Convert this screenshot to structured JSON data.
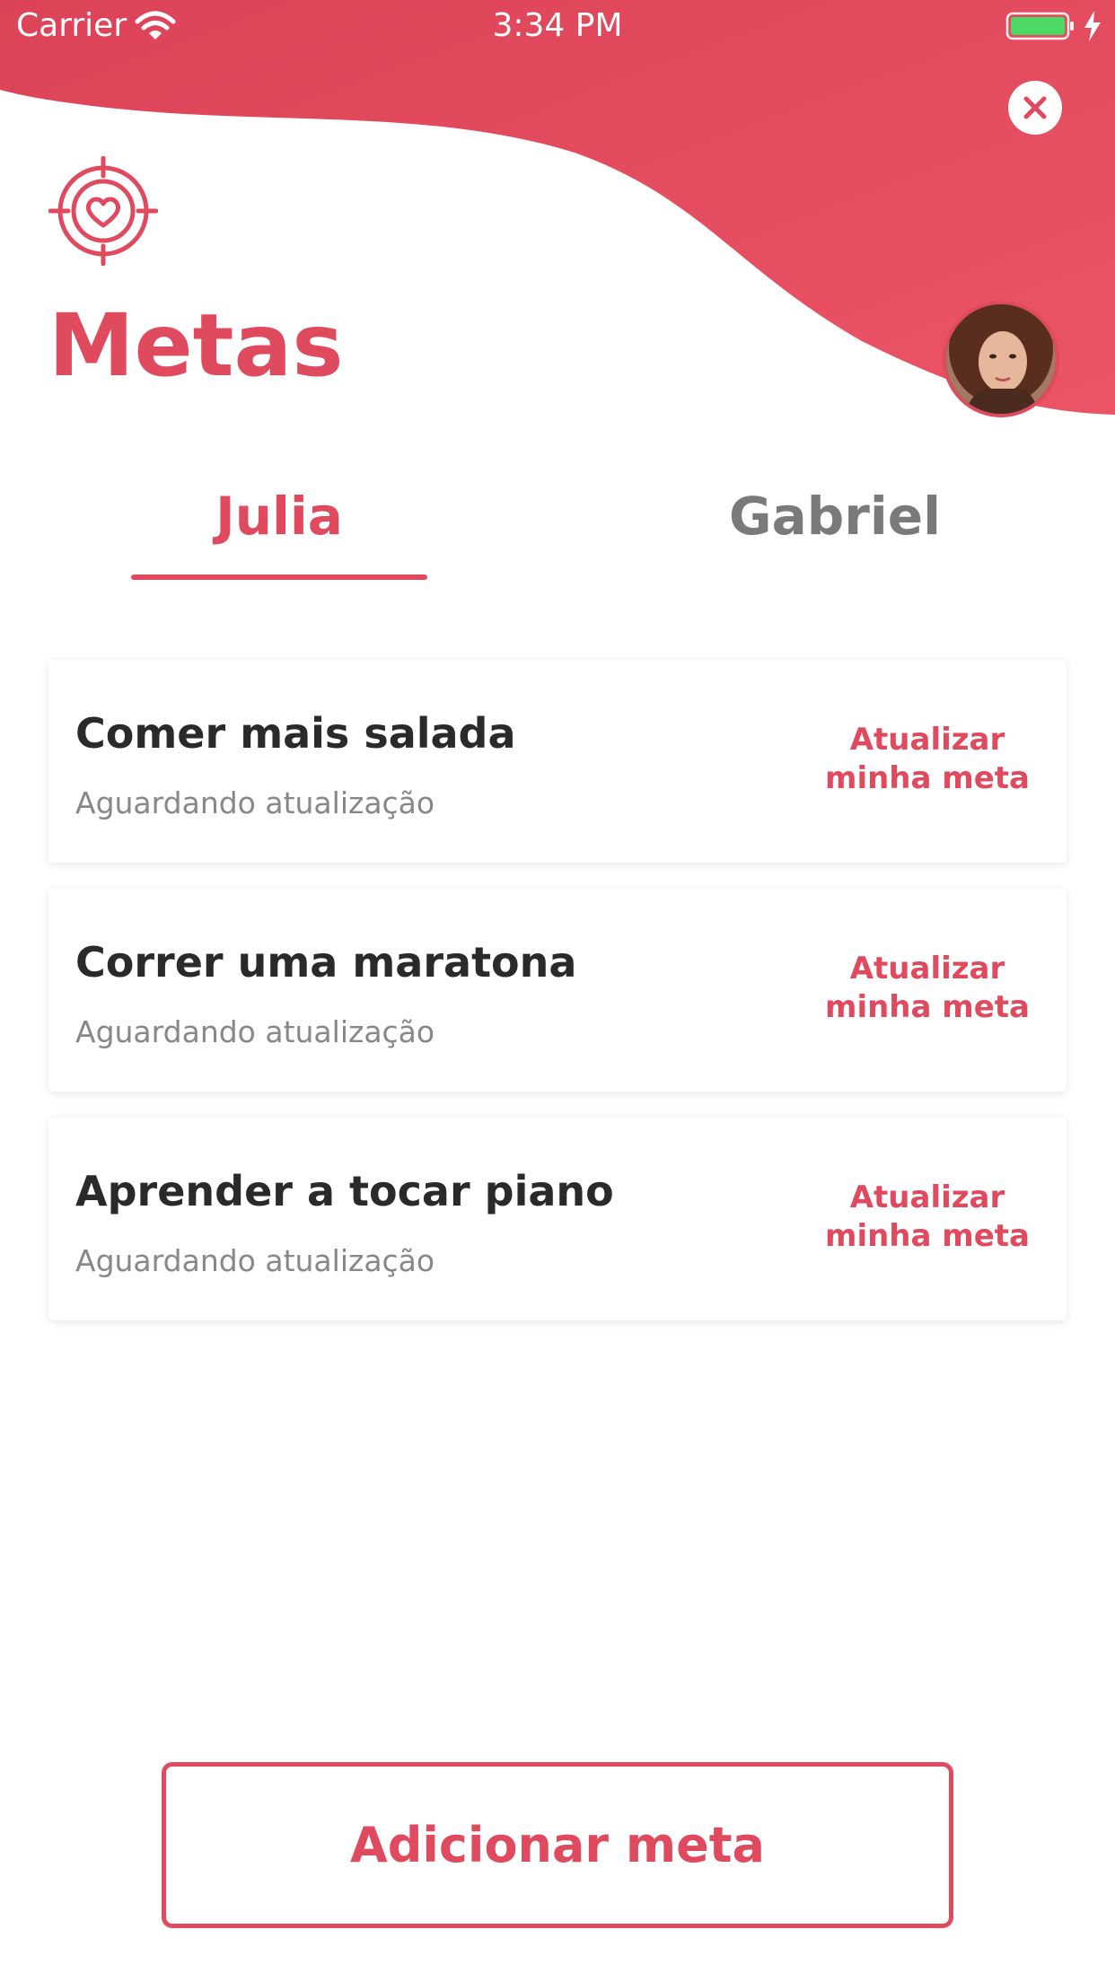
{
  "status_bar": {
    "carrier": "Carrier",
    "time": "3:34 PM",
    "wifi_icon": "wifi-icon",
    "battery_icon": "battery-icon"
  },
  "header": {
    "close_icon": "close-icon",
    "logo_icon": "target-heart-icon",
    "title": "Metas",
    "avatar": "user-avatar"
  },
  "tabs": [
    {
      "label": "Julia",
      "selected": true
    },
    {
      "label": "Gabriel",
      "selected": false
    }
  ],
  "goals": [
    {
      "title": "Comer mais salada",
      "status": "Aguardando atualização",
      "action": "Atualizar minha meta"
    },
    {
      "title": "Correr uma maratona",
      "status": "Aguardando atualização",
      "action": "Atualizar minha meta"
    },
    {
      "title": "Aprender a tocar piano",
      "status": "Aguardando atualização",
      "action": "Atualizar minha meta"
    }
  ],
  "add_button": {
    "label": "Adicionar meta"
  },
  "colors": {
    "accent": "#e04a5f",
    "accent_light": "#ea5467",
    "text_dark": "#2a2a2a",
    "text_muted": "#888888"
  }
}
